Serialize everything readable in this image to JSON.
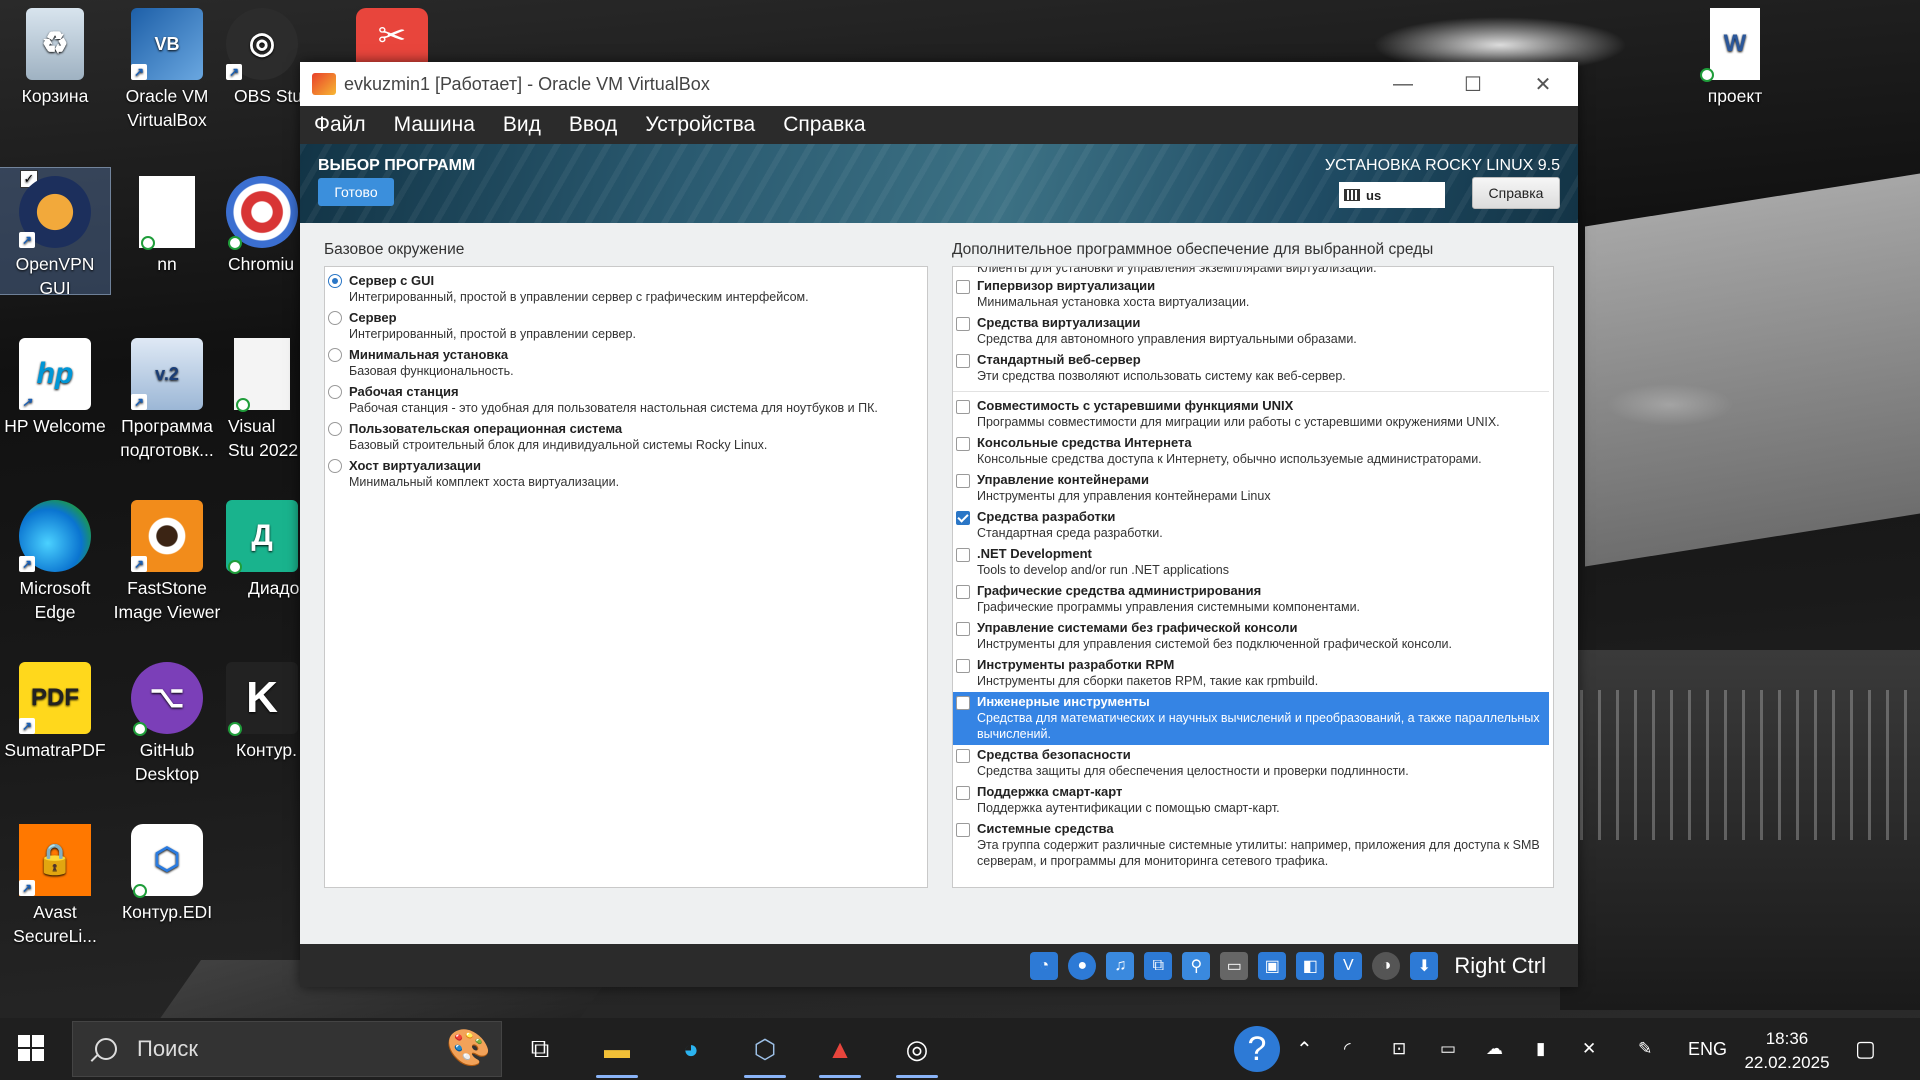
{
  "desktop": {
    "icons": [
      {
        "label": "Корзина"
      },
      {
        "label": "Oracle VM VirtualBox"
      },
      {
        "label": "OBS Stu"
      },
      {
        "label": "OpenVPN GUI"
      },
      {
        "label": "nn"
      },
      {
        "label": "Chromiu"
      },
      {
        "label": "HP Welcome"
      },
      {
        "label": "Программа подготовк..."
      },
      {
        "label": "Visual Stu 2022"
      },
      {
        "label": "Microsoft Edge"
      },
      {
        "label": "FastStone Image Viewer"
      },
      {
        "label": "Диадо"
      },
      {
        "label": "SumatraPDF"
      },
      {
        "label": "GitHub Desktop"
      },
      {
        "label": "Контур."
      },
      {
        "label": "Avast SecureLi..."
      },
      {
        "label": "Контур.EDI"
      },
      {
        "label": "проект"
      }
    ]
  },
  "vbox": {
    "title": "evkuzmin1 [Работает] - Oracle VM VirtualBox",
    "menu": [
      "Файл",
      "Машина",
      "Вид",
      "Ввод",
      "Устройства",
      "Справка"
    ],
    "host_key": "Right Ctrl"
  },
  "installer": {
    "screen_title": "ВЫБОР ПРОГРАММ",
    "done_label": "Готово",
    "product": "УСТАНОВКА ROCKY LINUX 9.5",
    "keyboard": "us",
    "help_label": "Справка",
    "base_label": "Базовое окружение",
    "addons_label": "Дополнительное программное обеспечение для выбранной среды",
    "environments": [
      {
        "name": "Сервер с GUI",
        "desc": "Интегрированный, простой в управлении сервер с графическим интерфейсом.",
        "selected": true
      },
      {
        "name": "Сервер",
        "desc": "Интегрированный, простой в управлении сервер.",
        "selected": false
      },
      {
        "name": "Минимальная установка",
        "desc": "Базовая функциональность.",
        "selected": false
      },
      {
        "name": "Рабочая станция",
        "desc": "Рабочая станция - это удобная для пользователя настольная система для ноутбуков и ПК.",
        "selected": false
      },
      {
        "name": "Пользовательская операционная система",
        "desc": "Базовый строительный блок для индивидуальной системы Rocky Linux.",
        "selected": false
      },
      {
        "name": "Хост виртуализации",
        "desc": "Минимальный комплект хоста виртуализации.",
        "selected": false
      }
    ],
    "addons_top_partial": "Клиенты для установки и управления экземплярами виртуализации.",
    "addons": [
      {
        "name": "Гипервизор виртуализации",
        "desc": "Минимальная установка хоста виртуализации.",
        "checked": false
      },
      {
        "name": "Средства виртуализации",
        "desc": "Средства для автономного управления виртуальными образами.",
        "checked": false
      },
      {
        "name": "Стандартный веб-сервер",
        "desc": "Эти средства позволяют использовать систему как веб-сервер.",
        "checked": false,
        "sep_after": true
      },
      {
        "name": "Совместимость с устаревшими функциями UNIX",
        "desc": "Программы совместимости для миграции или работы с устаревшими окружениями UNIX.",
        "checked": false
      },
      {
        "name": "Консольные средства Интернета",
        "desc": "Консольные средства доступа к Интернету, обычно используемые администраторами.",
        "checked": false
      },
      {
        "name": "Управление контейнерами",
        "desc": "Инструменты для управления контейнерами Linux",
        "checked": false
      },
      {
        "name": "Средства разработки",
        "desc": "Стандартная среда разработки.",
        "checked": true
      },
      {
        "name": ".NET Development",
        "desc": "Tools to develop and/or run .NET applications",
        "checked": false
      },
      {
        "name": "Графические средства администрирования",
        "desc": "Графические программы управления системными компонентами.",
        "checked": false
      },
      {
        "name": "Управление системами без графической консоли",
        "desc": "Инструменты для управления системой без подключенной графической консоли.",
        "checked": false
      },
      {
        "name": "Инструменты разработки RPM",
        "desc": "Инструменты для сборки пакетов RPM, такие как rpmbuild.",
        "checked": false
      },
      {
        "name": "Инженерные инструменты",
        "desc": "Средства для математических и научных вычислений и преобразований, а также параллельных вычислений.",
        "checked": false,
        "highlighted": true
      },
      {
        "name": "Средства безопасности",
        "desc": "Средства защиты для обеспечения целостности и проверки подлинности.",
        "checked": false
      },
      {
        "name": "Поддержка смарт-карт",
        "desc": "Поддержка аутентификации с помощью смарт-карт.",
        "checked": false
      },
      {
        "name": "Системные средства",
        "desc": "Эта группа содержит различные системные утилиты: например, приложения для доступа к SMB серверам, и программы для мониторинга сетевого трафика.",
        "checked": false
      }
    ]
  },
  "taskbar": {
    "search_placeholder": "Поиск",
    "lang": "ENG",
    "time": "18:36",
    "date": "22.02.2025"
  }
}
